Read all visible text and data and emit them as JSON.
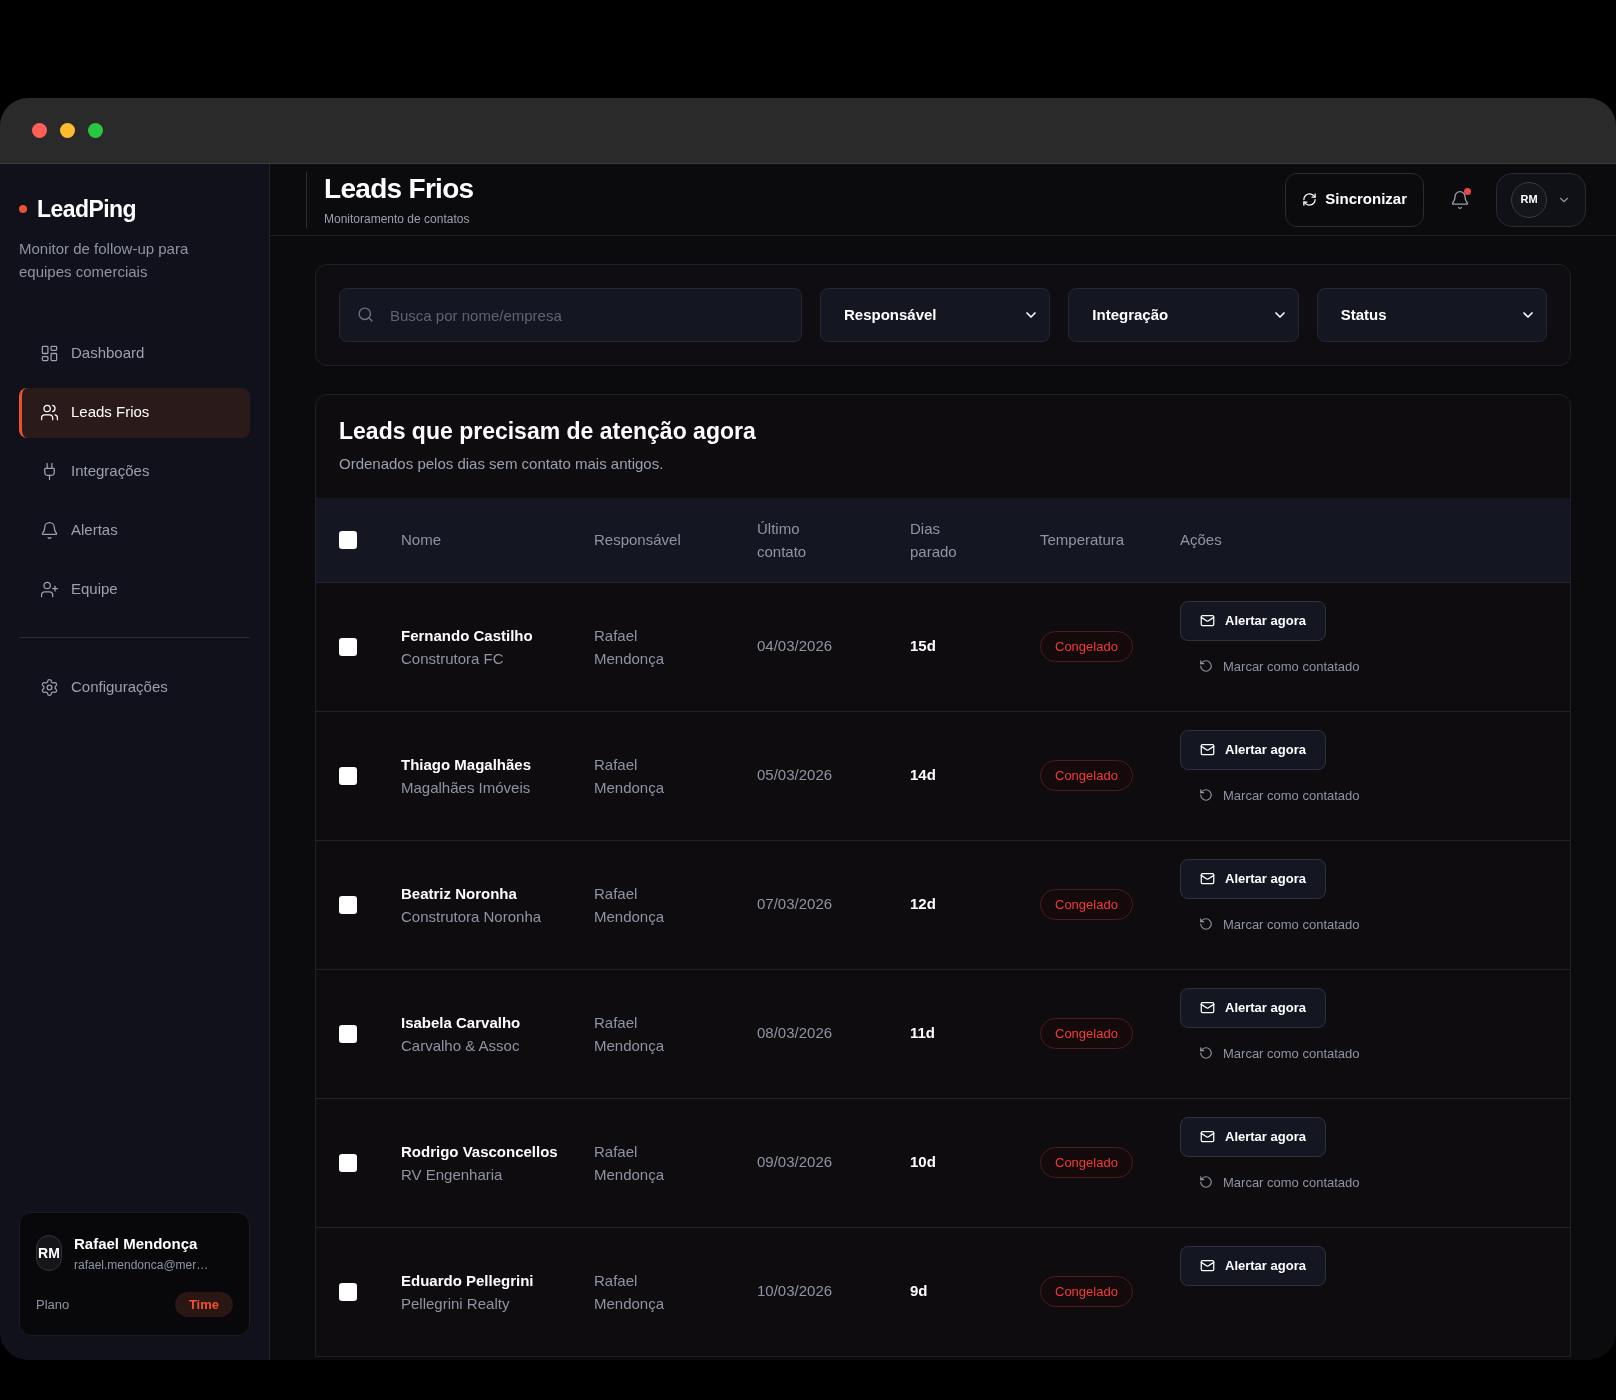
{
  "sidebar": {
    "brand": "LeadPing",
    "tagline": "Monitor de follow-up para equipes comerciais",
    "nav": [
      {
        "label": "Dashboard",
        "selected": false
      },
      {
        "label": "Leads Frios",
        "selected": true
      },
      {
        "label": "Integrações",
        "selected": false
      },
      {
        "label": "Alertas",
        "selected": false
      },
      {
        "label": "Equipe",
        "selected": false
      }
    ],
    "settings": {
      "label": "Configurações",
      "selected": false
    },
    "user": {
      "initials": "RM",
      "name": "Rafael Mendonça",
      "email": "rafael.mendonca@mer…",
      "plan_label": "Plano",
      "plan": "Time"
    }
  },
  "header": {
    "title": "Leads Frios",
    "subtitle": "Monitoramento de contatos",
    "sync_button": "Sincronizar",
    "notifications": {
      "unread": true
    },
    "avatar": "RM"
  },
  "filters": {
    "search": {
      "placeholder": "Busca por nome/empresa"
    },
    "selects": [
      "Responsável",
      "Integração",
      "Status"
    ]
  },
  "table": {
    "title": "Leads que precisam de atenção agora",
    "subtitle": "Ordenados pelos dias sem contato mais antigos.",
    "select_all": {
      "checked": false
    },
    "columns": [
      "Nome",
      "Responsável",
      "Último contato",
      "Dias parado",
      "Temperatura",
      "Ações"
    ],
    "rows": [
      {
        "selected": false,
        "name": "Fernando Castilho",
        "company": "Construtora FC",
        "owner": "Rafael Mendonça",
        "last_contact": "04/03/2026",
        "days_idle": "15d",
        "temperature": "Congelado",
        "alert_button": "Alertar agora",
        "mark_button": "Marcar como contatado"
      },
      {
        "selected": false,
        "name": "Thiago Magalhães",
        "company": "Magalhães Imóveis",
        "owner": "Rafael Mendonça",
        "last_contact": "05/03/2026",
        "days_idle": "14d",
        "temperature": "Congelado",
        "alert_button": "Alertar agora",
        "mark_button": "Marcar como contatado"
      },
      {
        "selected": false,
        "name": "Beatriz Noronha",
        "company": "Construtora Noronha",
        "owner": "Rafael Mendonça",
        "last_contact": "07/03/2026",
        "days_idle": "12d",
        "temperature": "Congelado",
        "alert_button": "Alertar agora",
        "mark_button": "Marcar como contatado"
      },
      {
        "selected": false,
        "name": "Isabela Carvalho",
        "company": "Carvalho & Assoc",
        "owner": "Rafael Mendonça",
        "last_contact": "08/03/2026",
        "days_idle": "11d",
        "temperature": "Congelado",
        "alert_button": "Alertar agora",
        "mark_button": "Marcar como contatado"
      },
      {
        "selected": false,
        "name": "Rodrigo Vasconcellos",
        "company": "RV Engenharia",
        "owner": "Rafael Mendonça",
        "last_contact": "09/03/2026",
        "days_idle": "10d",
        "temperature": "Congelado",
        "alert_button": "Alertar agora",
        "mark_button": "Marcar como contatado"
      },
      {
        "selected": false,
        "name": "Eduardo Pellegrini",
        "company": "Pellegrini Realty",
        "owner": "Rafael Mendonça",
        "last_contact": "10/03/2026",
        "days_idle": "9d",
        "temperature": "Congelado",
        "alert_button": "Alertar agora"
      }
    ]
  }
}
